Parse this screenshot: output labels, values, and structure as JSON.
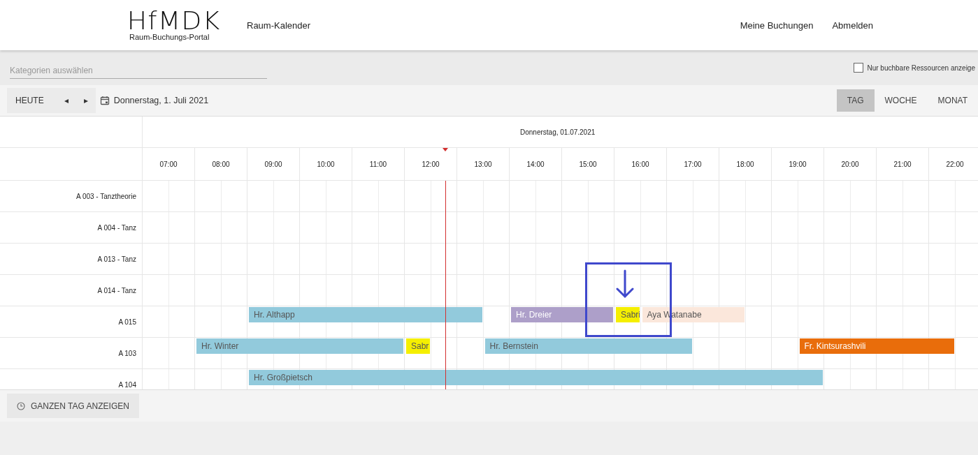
{
  "header": {
    "logo": "HfMDK",
    "logo_subtitle": "Raum-Buchungs-Portal",
    "title": "Raum-Kalender",
    "nav": [
      "Meine Buchungen",
      "Abmelden"
    ]
  },
  "filter": {
    "placeholder": "Kategorien auswählen",
    "checkbox": {
      "label": "Nur buchbare Ressourcen anzeige",
      "checked": false
    }
  },
  "toolbar": {
    "today": "HEUTE",
    "prev": "◂",
    "next": "▸",
    "date": "Donnerstag, 1. Juli 2021",
    "views": [
      {
        "label": "TAG",
        "selected": true
      },
      {
        "label": "WOCHE",
        "selected": false
      },
      {
        "label": "MONAT",
        "selected": false
      }
    ]
  },
  "calendar": {
    "date_heading": "Donnerstag, 01.07.2021",
    "hours": [
      "07:00",
      "08:00",
      "09:00",
      "10:00",
      "11:00",
      "12:00",
      "13:00",
      "14:00",
      "15:00",
      "16:00",
      "17:00",
      "18:00",
      "19:00",
      "20:00",
      "21:00",
      "22:00"
    ],
    "rooms": [
      {
        "name": "A 003 - Tanztheorie"
      },
      {
        "name": "A 004 - Tanz"
      },
      {
        "name": "A 013 - Tanz"
      },
      {
        "name": "A 014 - Tanz"
      },
      {
        "name": "A 015",
        "events": [
          {
            "label": "Hr. Althapp",
            "color": "#92cadc"
          },
          {
            "label": "Hr. Dreier",
            "color": "#ad9fc9"
          },
          {
            "label": "Sabri",
            "color": "#f5ef00"
          },
          {
            "label": "Aya Watanabe",
            "color": "#fbe7db"
          }
        ]
      },
      {
        "name": "A 103",
        "events": [
          {
            "label": "Hr. Winter",
            "color": "#92cadc"
          },
          {
            "label": "Sabr",
            "color": "#f5ef00"
          },
          {
            "label": "Hr. Bernstein",
            "color": "#92cadc"
          },
          {
            "label": "Fr. Kintsurashvili",
            "color": "#e96d0b"
          }
        ]
      },
      {
        "name": "A 104",
        "events": [
          {
            "label": "Hr. Großpietsch",
            "color": "#92cadc"
          }
        ]
      }
    ],
    "annotation": {
      "kind": "highlight"
    }
  },
  "footer": {
    "button": "GANZEN TAG ANZEIGEN"
  }
}
